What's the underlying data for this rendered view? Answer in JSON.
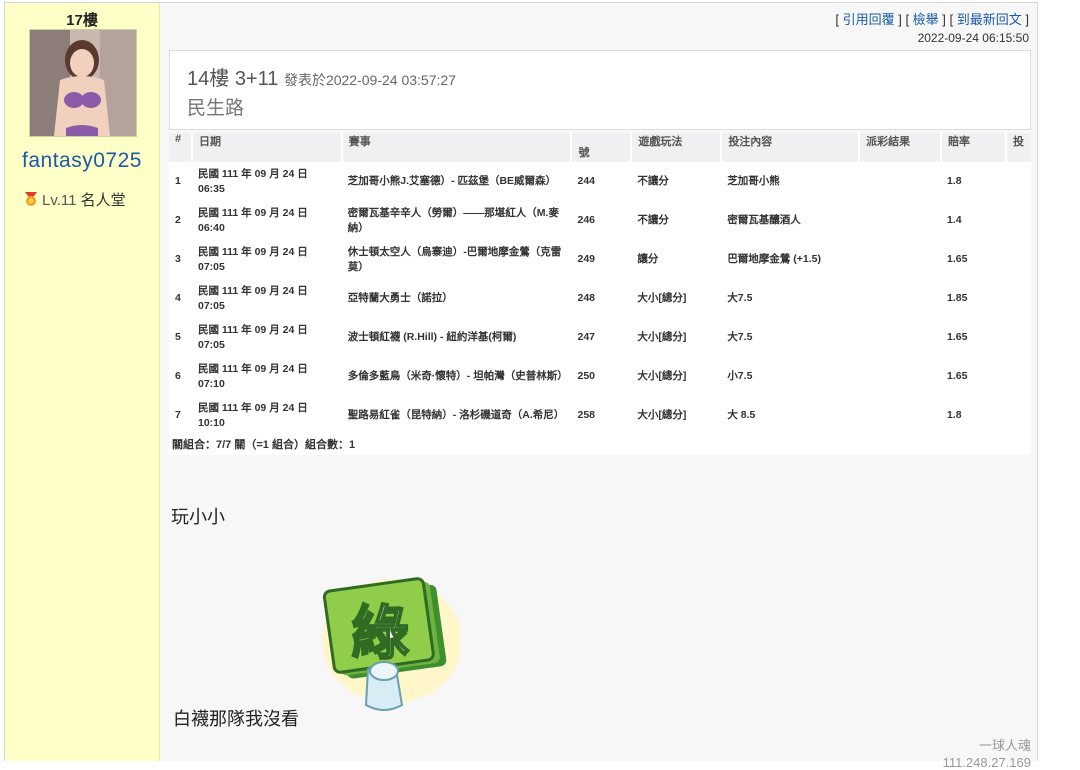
{
  "user": {
    "floor": "17樓",
    "username": "fantasy0725",
    "level": "Lv.11",
    "rank": "名人堂"
  },
  "actions": {
    "quote": "引用回覆",
    "report": "檢舉",
    "latest": "到最新回文"
  },
  "post_time": "2022-09-24 06:15:50",
  "quote": {
    "floor": "14樓",
    "title": "3+11",
    "posted_label": "發表於2022-09-24 03:57:27",
    "text": "民生路"
  },
  "bets": {
    "headers": [
      "#",
      "日期",
      "賽事",
      "號",
      "遊戲玩法",
      "投注內容",
      "派彩結果",
      "賠率",
      "投"
    ],
    "rows": [
      {
        "no": "1",
        "date": "民國 111 年 09 月 24 日 06:35",
        "match": "芝加哥小熊J.艾塞德）- 匹茲堡（BE威爾森）",
        "code": "244",
        "play": "不讓分",
        "pick": "芝加哥小熊",
        "odds": "1.8"
      },
      {
        "no": "2",
        "date": "民國 111 年 09 月 24 日 06:40",
        "match": "密爾瓦基辛辛人（勞爾）——那堪紅人（M.麥納）",
        "code": "246",
        "play": "不讓分",
        "pick": "密爾瓦基釀酒人",
        "odds": "1.4"
      },
      {
        "no": "3",
        "date": "民國 111 年 09 月 24 日 07:05",
        "match": "休士頓太空人（烏寨迪）-巴爾地摩金鶯（克雷莫）",
        "code": "249",
        "play": "讓分",
        "pick": "巴爾地摩金鶯 (+1.5)",
        "odds": "1.65"
      },
      {
        "no": "4",
        "date": "民國 111 年 09 月 24 日 07:05",
        "match": "亞特蘭大勇士（諾拉）",
        "code": "248",
        "play": "大小[總分]",
        "pick": "大7.5",
        "odds": "1.85"
      },
      {
        "no": "5",
        "date": "民國 111 年 09 月 24 日 07:05",
        "match": "波士頓紅襪 (R.Hill) - 紐約洋基(柯爾)",
        "code": "247",
        "play": "大小[總分]",
        "pick": "大7.5",
        "odds": "1.65"
      },
      {
        "no": "6",
        "date": "民國 111 年 09 月 24 日 07:10",
        "match": "多倫多藍鳥（米奇·懷特）- 坦帕灣（史普林斯）",
        "code": "250",
        "play": "大小[總分]",
        "pick": "小7.5",
        "odds": "1.65"
      },
      {
        "no": "7",
        "date": "民國 111 年 09 月 24 日 10:10",
        "match": "聖路易紅雀（昆特納）- 洛杉磯道奇（A.希尼）",
        "code": "258",
        "play": "大小[總分]",
        "pick": "大 8.5",
        "odds": "1.8"
      }
    ],
    "summary": "關組合：7/7 關（=1 組合）組合數：1"
  },
  "message_1": "玩小小",
  "sticker": {
    "glyph": "綠"
  },
  "message_2": "白襪那隊我沒看",
  "signature": "一球人魂",
  "ip": "111.248.27.169",
  "colors": {
    "sidebar_bg": "#ffffc8",
    "link": "#1a5aa8",
    "sticker_green": "#7cc242"
  }
}
